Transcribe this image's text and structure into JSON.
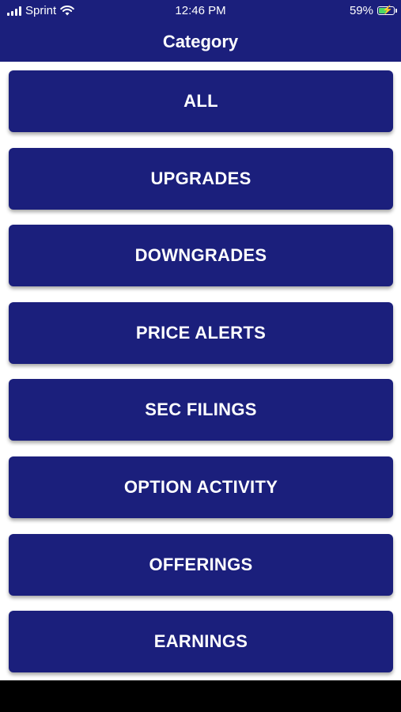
{
  "status_bar": {
    "carrier": "Sprint",
    "time": "12:46 PM",
    "battery_percent": "59%",
    "battery_level": 0.59,
    "icons": [
      "signal-bars-icon",
      "wifi-icon",
      "battery-charging-icon"
    ]
  },
  "header": {
    "title": "Category",
    "color": "#1b1f7c"
  },
  "categories": [
    {
      "label": "ALL"
    },
    {
      "label": "UPGRADES"
    },
    {
      "label": "DOWNGRADES"
    },
    {
      "label": "PRICE ALERTS"
    },
    {
      "label": "SEC FILINGS"
    },
    {
      "label": "OPTION ACTIVITY"
    },
    {
      "label": "OFFERINGS"
    },
    {
      "label": "EARNINGS"
    }
  ]
}
